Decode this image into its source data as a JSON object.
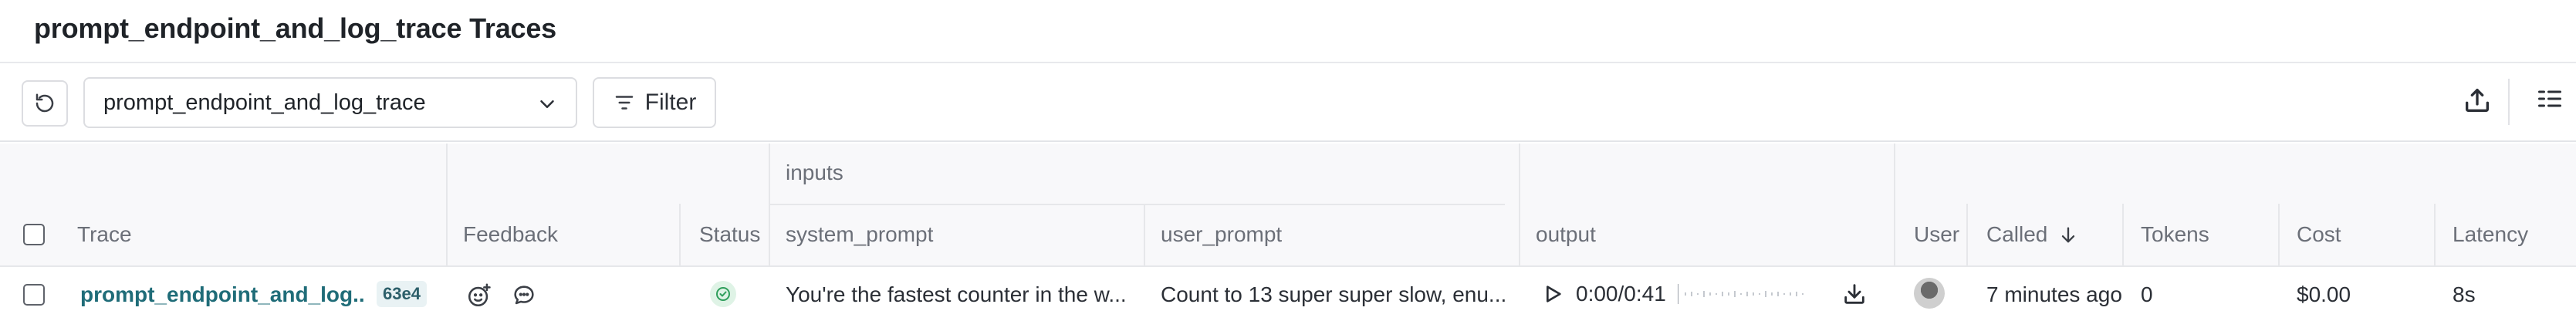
{
  "page": {
    "title": "prompt_endpoint_and_log_trace Traces"
  },
  "toolbar": {
    "refresh_icon": "refresh-icon",
    "select_value": "prompt_endpoint_and_log_trace",
    "filter_label": "Filter",
    "export_icon": "upload-icon",
    "columns_icon": "columns-icon"
  },
  "table": {
    "group_header": "inputs",
    "columns": {
      "trace": "Trace",
      "feedback": "Feedback",
      "status": "Status",
      "system_prompt": "system_prompt",
      "user_prompt": "user_prompt",
      "output": "output",
      "user": "User",
      "called": "Called",
      "tokens": "Tokens",
      "cost": "Cost",
      "latency": "Latency"
    },
    "rows": [
      {
        "trace": "prompt_endpoint_and_log...",
        "trace_id": "63e4",
        "status": "success",
        "system_prompt": "You're the fastest counter in the w...",
        "user_prompt": "Count to 13 super super slow, enu...",
        "output_time": "0:00/0:41",
        "called": "7 minutes ago",
        "tokens": "0",
        "cost": "$0.00",
        "latency": "8s"
      }
    ]
  },
  "colors": {
    "link": "#1f6c78",
    "success": "#2f9e5b",
    "border": "#e6e7ea",
    "muted_text": "#6b6f78"
  }
}
